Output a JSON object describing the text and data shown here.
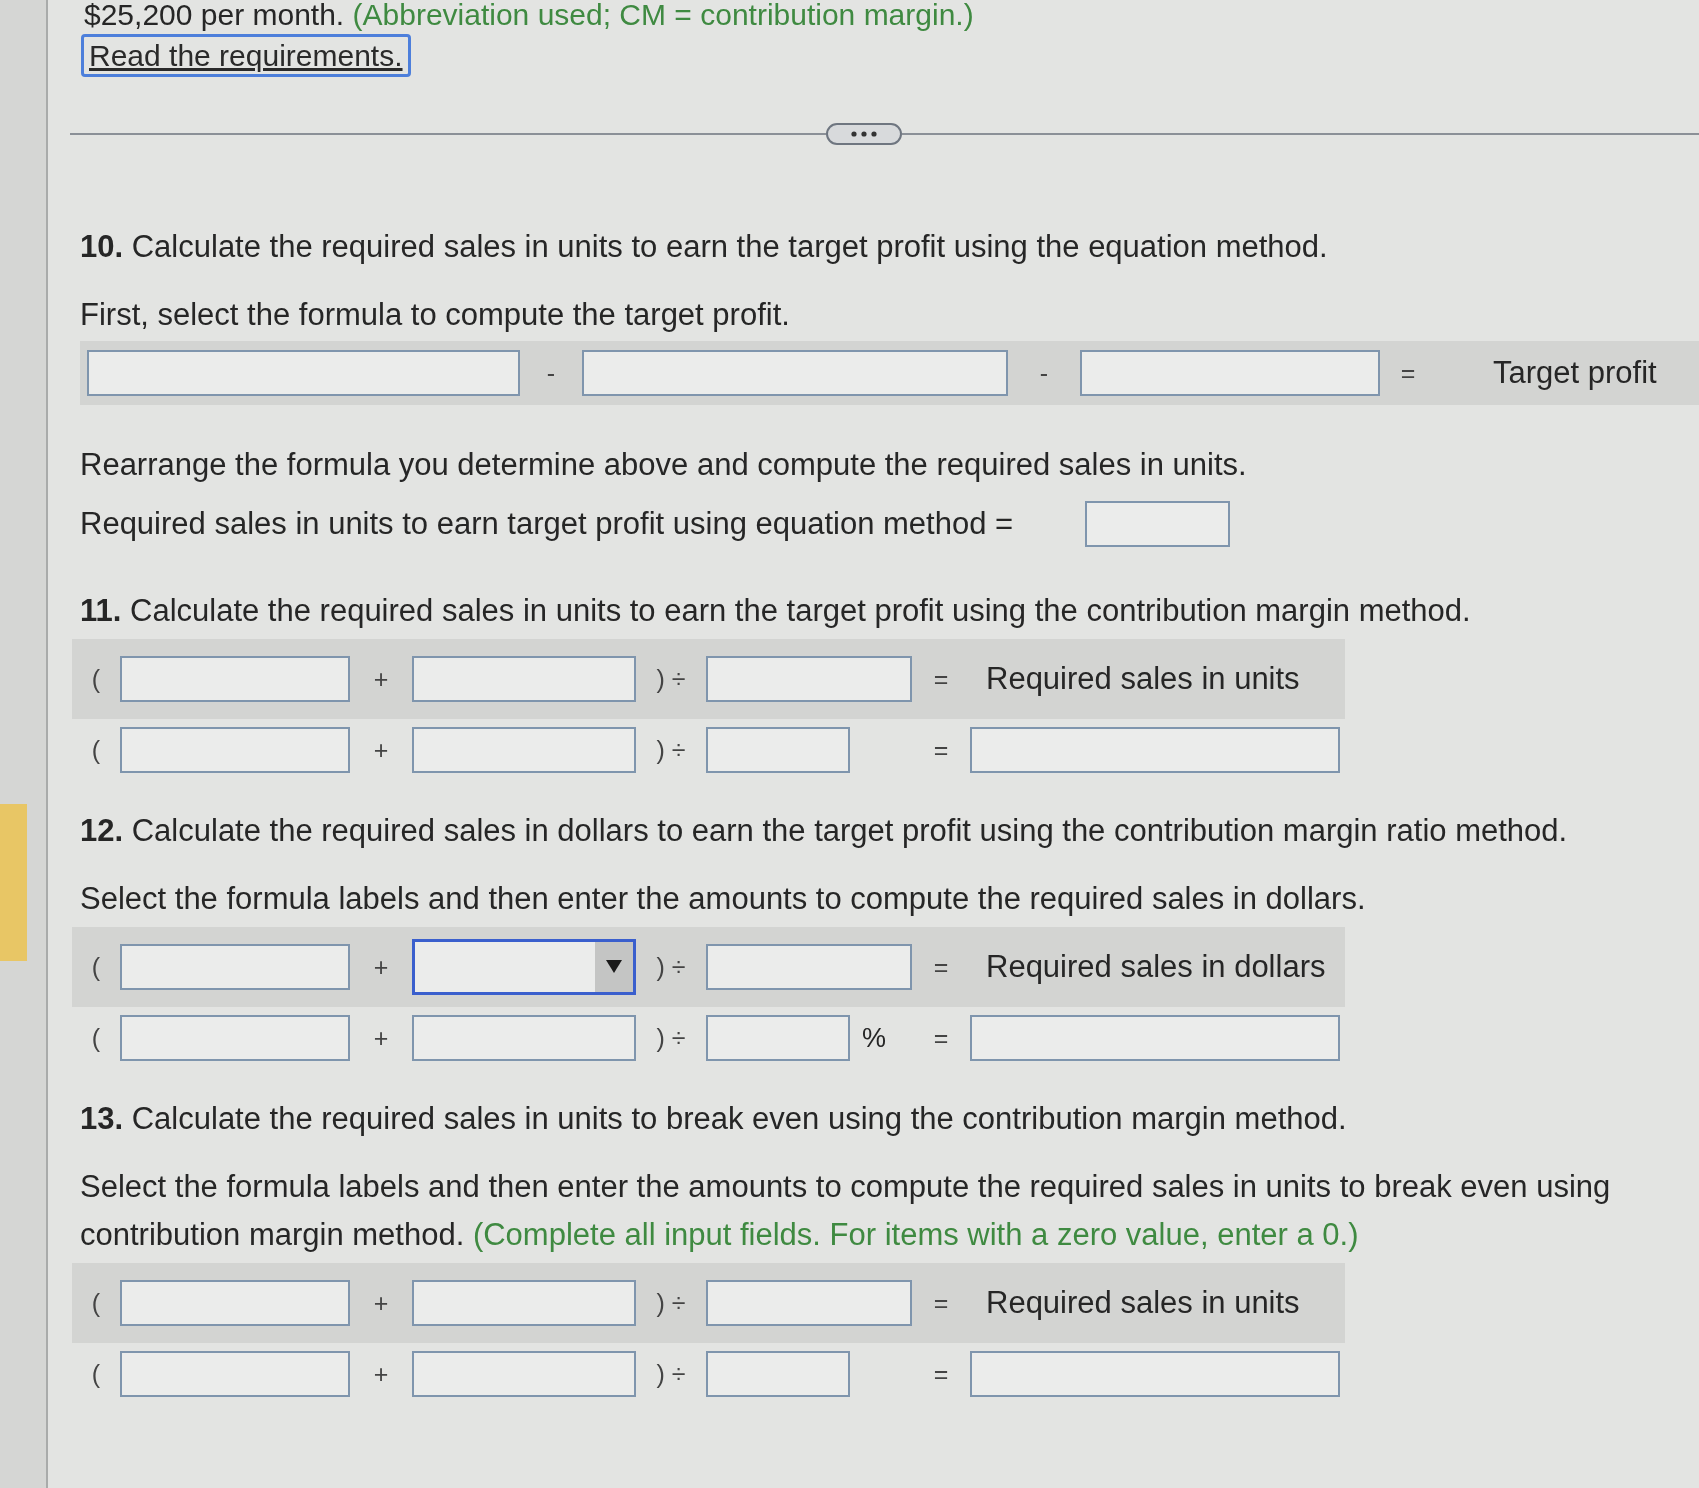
{
  "intro": {
    "text": "$25,200 per month.",
    "note": "(Abbreviation used; CM = contribution margin.)"
  },
  "requirements_link": {
    "label": "Read the requirements."
  },
  "questions": [
    {
      "number": "10.",
      "title": "Calculate the required sales in units to earn the target profit using the equation method.",
      "highlighted": false,
      "blocks": [
        {
          "kind": "instruction",
          "text": "First, select the formula to compute the target profit."
        },
        {
          "kind": "equation",
          "cells": [
            {
              "kind": "field"
            },
            {
              "kind": "symbol",
              "text": "-"
            },
            {
              "kind": "field"
            },
            {
              "kind": "symbol",
              "text": "-"
            },
            {
              "kind": "field"
            },
            {
              "kind": "symbol",
              "text": "="
            },
            {
              "kind": "label",
              "text": "Target profit"
            }
          ]
        },
        {
          "kind": "instruction",
          "text": "Rearrange the formula you determine above and compute the required sales in units."
        },
        {
          "kind": "answer",
          "label": "Required sales in units to earn target profit using equation method ="
        }
      ]
    },
    {
      "number": "11.",
      "title": "Calculate the required sales in units to earn the target profit using the contribution margin method.",
      "highlighted": false,
      "blocks": [
        {
          "kind": "formula_table",
          "rows": [
            {
              "cells": [
                {
                  "kind": "symbol",
                  "text": "("
                },
                {
                  "kind": "field"
                },
                {
                  "kind": "symbol",
                  "text": "+"
                },
                {
                  "kind": "field"
                },
                {
                  "kind": "symbol",
                  "text": ") ÷"
                },
                {
                  "kind": "field"
                },
                {
                  "kind": "symbol",
                  "text": "="
                },
                {
                  "kind": "label",
                  "text": "Required sales in units"
                }
              ]
            },
            {
              "cells": [
                {
                  "kind": "symbol",
                  "text": "("
                },
                {
                  "kind": "field"
                },
                {
                  "kind": "symbol",
                  "text": "+"
                },
                {
                  "kind": "field"
                },
                {
                  "kind": "symbol",
                  "text": ") ÷"
                },
                {
                  "kind": "field"
                },
                {
                  "kind": "symbol",
                  "text": "="
                },
                {
                  "kind": "field"
                }
              ]
            }
          ]
        }
      ]
    },
    {
      "number": "12.",
      "title": "Calculate the required sales in dollars to earn the target profit using the contribution margin ratio method.",
      "highlighted": true,
      "blocks": [
        {
          "kind": "instruction",
          "text": "Select the formula labels and then enter the amounts to compute the required sales in dollars."
        },
        {
          "kind": "formula_table",
          "rows": [
            {
              "cells": [
                {
                  "kind": "symbol",
                  "text": "("
                },
                {
                  "kind": "field"
                },
                {
                  "kind": "symbol",
                  "text": "+"
                },
                {
                  "kind": "select",
                  "focused": true
                },
                {
                  "kind": "symbol",
                  "text": ") ÷"
                },
                {
                  "kind": "field"
                },
                {
                  "kind": "symbol",
                  "text": "="
                },
                {
                  "kind": "label",
                  "text": "Required sales in dollars"
                }
              ]
            },
            {
              "cells": [
                {
                  "kind": "symbol",
                  "text": "("
                },
                {
                  "kind": "field"
                },
                {
                  "kind": "symbol",
                  "text": "+"
                },
                {
                  "kind": "field"
                },
                {
                  "kind": "symbol",
                  "text": ") ÷"
                },
                {
                  "kind": "field",
                  "unit": "%"
                },
                {
                  "kind": "symbol",
                  "text": "="
                },
                {
                  "kind": "field"
                }
              ]
            }
          ]
        }
      ]
    },
    {
      "number": "13.",
      "title": "Calculate the required sales in units to break even using the contribution margin method.",
      "highlighted": false,
      "blocks": [
        {
          "kind": "instruction",
          "text": "Select the formula labels and then enter the amounts to compute the required sales in units to break even using contribution margin method.",
          "hint": "(Complete all input fields. For items with a zero value, enter a 0.)"
        },
        {
          "kind": "formula_table",
          "rows": [
            {
              "cells": [
                {
                  "kind": "symbol",
                  "text": "("
                },
                {
                  "kind": "field"
                },
                {
                  "kind": "symbol",
                  "text": "+"
                },
                {
                  "kind": "field"
                },
                {
                  "kind": "symbol",
                  "text": ") ÷"
                },
                {
                  "kind": "field"
                },
                {
                  "kind": "symbol",
                  "text": "="
                },
                {
                  "kind": "label",
                  "text": "Required sales in units"
                }
              ]
            },
            {
              "cells": [
                {
                  "kind": "symbol",
                  "text": "("
                },
                {
                  "kind": "field"
                },
                {
                  "kind": "symbol",
                  "text": "+"
                },
                {
                  "kind": "field"
                },
                {
                  "kind": "symbol",
                  "text": ") ÷"
                },
                {
                  "kind": "field"
                },
                {
                  "kind": "symbol",
                  "text": "="
                },
                {
                  "kind": "field"
                }
              ]
            }
          ]
        }
      ]
    }
  ]
}
